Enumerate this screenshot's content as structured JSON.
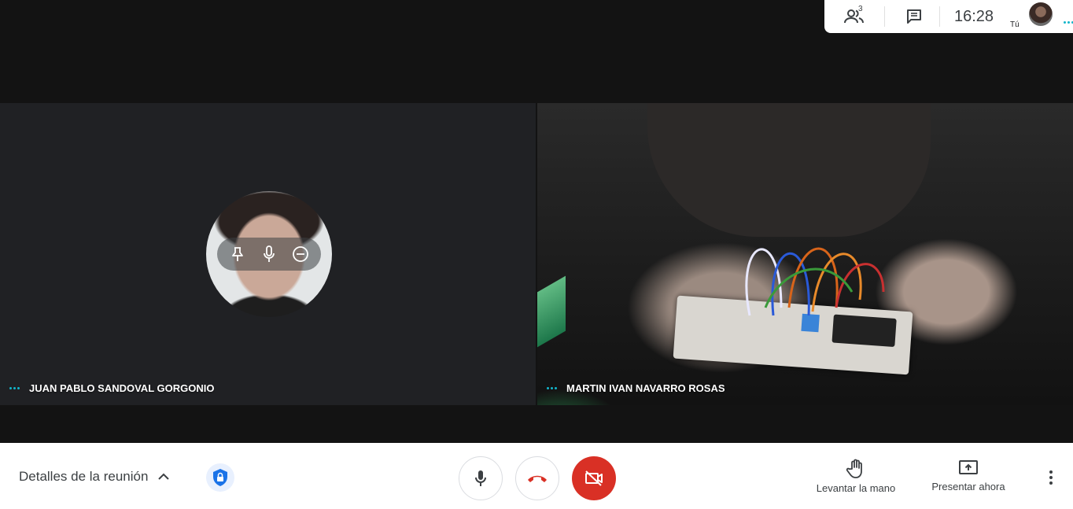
{
  "topbar": {
    "participants_count": "3",
    "participants_icon": "people-icon",
    "chat_icon": "chat-icon",
    "time": "16:28",
    "self_label": "Tú"
  },
  "tiles": [
    {
      "name": "JUAN PABLO SANDOVAL GORGONIO",
      "video": "avatar"
    },
    {
      "name": "MARTIN IVAN NAVARRO ROSAS",
      "video": "camera"
    }
  ],
  "tile_overlay_icons": [
    "pin-icon",
    "mic-icon",
    "remove-icon"
  ],
  "bottombar": {
    "details_label": "Detalles de la reunión",
    "raise_hand_label": "Levantar la mano",
    "present_label": "Presentar ahora"
  },
  "colors": {
    "accent_blue": "#1a73e8",
    "danger_red": "#d93025",
    "speaking_dots": "#12b5cb",
    "background": "#131313",
    "tile_bg": "#202124"
  }
}
